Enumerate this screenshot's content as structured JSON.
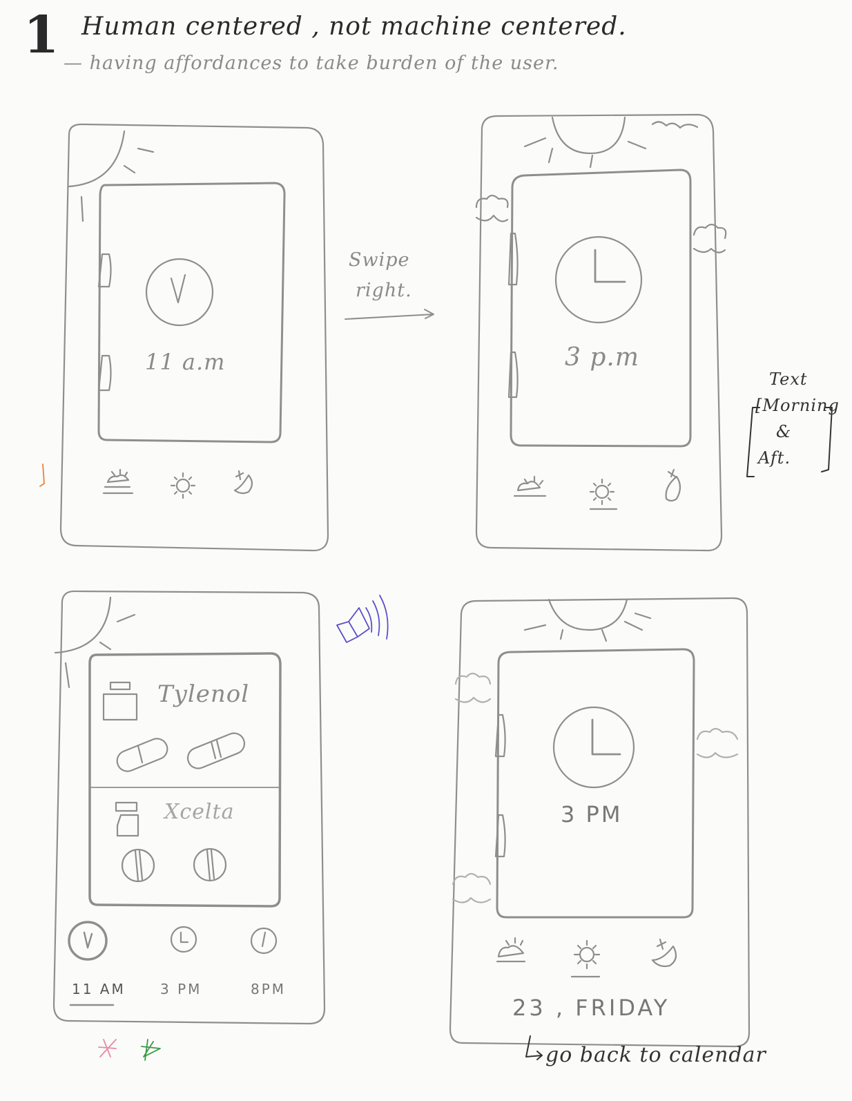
{
  "header": {
    "number": "1",
    "title": "Human centered , not machine centered.",
    "subtitle": "— having affordances to take burden of the user."
  },
  "panel1": {
    "time": "11 a.m"
  },
  "arrow": {
    "line1": "Swipe",
    "line2": "right."
  },
  "panel2": {
    "time": "3 p.m"
  },
  "side_note": {
    "line1": "Text",
    "line2": "[Morning",
    "line3": "&",
    "line4": "Aft."
  },
  "panel3": {
    "med1": "Tylenol",
    "med2": "Xcelta",
    "times": [
      "11 AM",
      "3 PM",
      "8PM"
    ]
  },
  "panel4": {
    "time": "3 PM",
    "date": "23 , FRIDAY",
    "note": "go back to calendar"
  },
  "icons": {
    "morning": "sunrise-icon",
    "afternoon": "sun-icon",
    "night": "moon-icon",
    "sound": "speaker-icon",
    "star": "star-icon"
  },
  "colors": {
    "pencil": "#8a8a8a",
    "ink": "#2a2a2a",
    "purple": "#5b4fc9",
    "orange": "#e8833a",
    "pink": "#e58aa4",
    "green": "#3a9a45"
  }
}
